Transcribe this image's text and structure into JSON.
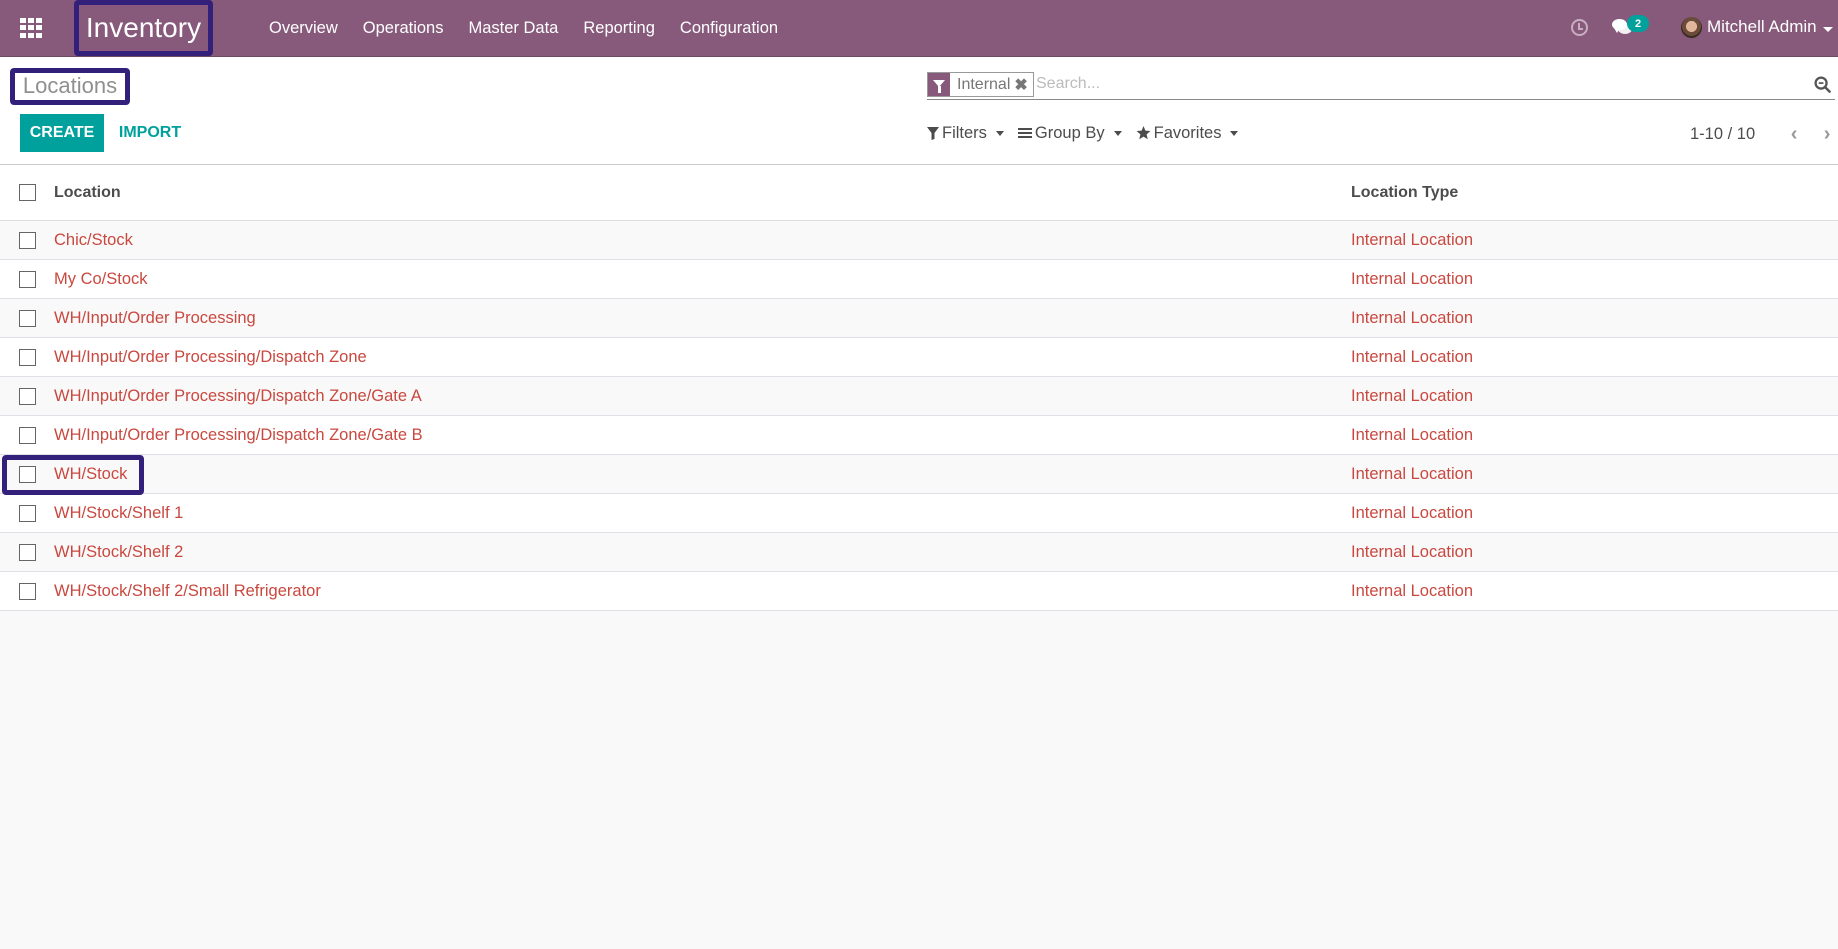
{
  "navbar": {
    "apps_icon": "apps-grid-icon",
    "app_name": "Inventory",
    "menu": [
      {
        "label": "Overview"
      },
      {
        "label": "Operations"
      },
      {
        "label": "Master Data"
      },
      {
        "label": "Reporting"
      },
      {
        "label": "Configuration"
      }
    ],
    "activity_icon": "clock-icon",
    "messages_icon": "chat-icon",
    "messages_count": "2",
    "user_name": "Mitchell Admin"
  },
  "control_panel": {
    "title": "Locations",
    "create_label": "CREATE",
    "import_label": "IMPORT",
    "search": {
      "facet_icon": "filter-icon",
      "facet_label": "Internal",
      "facet_remove": "✖",
      "placeholder": "Search...",
      "value": ""
    },
    "filters_label": "Filters",
    "group_by_label": "Group By",
    "favorites_label": "Favorites",
    "pager": {
      "value": "1-10 / 10",
      "prev": "‹",
      "next": "›"
    }
  },
  "list": {
    "columns": [
      "Location",
      "Location Type"
    ],
    "rows": [
      {
        "location": "Chic/Stock",
        "type": "Internal Location"
      },
      {
        "location": "My Co/Stock",
        "type": "Internal Location"
      },
      {
        "location": "WH/Input/Order Processing",
        "type": "Internal Location"
      },
      {
        "location": "WH/Input/Order Processing/Dispatch Zone",
        "type": "Internal Location"
      },
      {
        "location": "WH/Input/Order Processing/Dispatch Zone/Gate A",
        "type": "Internal Location"
      },
      {
        "location": "WH/Input/Order Processing/Dispatch Zone/Gate B",
        "type": "Internal Location"
      },
      {
        "location": "WH/Stock",
        "type": "Internal Location"
      },
      {
        "location": "WH/Stock/Shelf 1",
        "type": "Internal Location"
      },
      {
        "location": "WH/Stock/Shelf 2",
        "type": "Internal Location"
      },
      {
        "location": "WH/Stock/Shelf 2/Small Refrigerator",
        "type": "Internal Location"
      }
    ]
  },
  "colors": {
    "brand": "#875a7b",
    "primary": "#00a09d",
    "link": "#c9483f",
    "highlight": "#33207a"
  }
}
